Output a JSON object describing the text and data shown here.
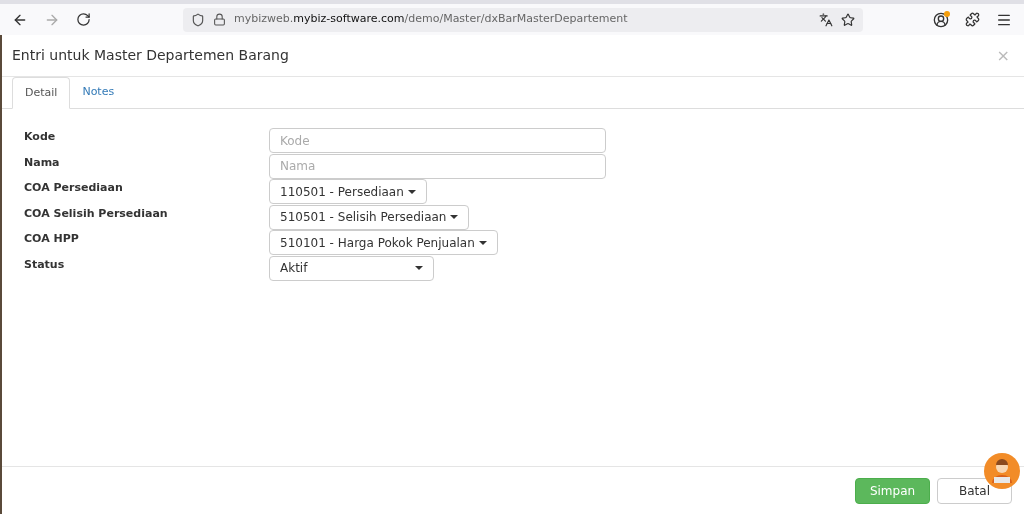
{
  "browser": {
    "url_prefix": "mybizweb.",
    "url_domain": "mybiz-software.com",
    "url_path": "/demo/Master/dxBarMasterDepartement",
    "profile_badge": true
  },
  "dialog": {
    "title": "Entri untuk Master Departemen Barang",
    "close": "×"
  },
  "tabs": [
    {
      "label": "Detail",
      "selected": true
    },
    {
      "label": "Notes",
      "selected": false
    }
  ],
  "fields": [
    {
      "kind": "text",
      "label": "Kode",
      "placeholder": "Kode"
    },
    {
      "kind": "text",
      "label": "Nama",
      "placeholder": "Nama"
    },
    {
      "kind": "dropdown",
      "label": "COA Persediaan",
      "value": "110501 - Persediaan"
    },
    {
      "kind": "dropdown",
      "label": "COA Selisih Persediaan",
      "value": "510501 - Selisih Persediaan"
    },
    {
      "kind": "dropdown",
      "label": "COA HPP",
      "value": "510101 - Harga Pokok Penjualan"
    },
    {
      "kind": "select",
      "label": "Status",
      "value": "Aktif"
    }
  ],
  "buttons": [
    {
      "kind": "primary",
      "label": "Simpan"
    },
    {
      "kind": "default",
      "label": "Batal"
    }
  ]
}
